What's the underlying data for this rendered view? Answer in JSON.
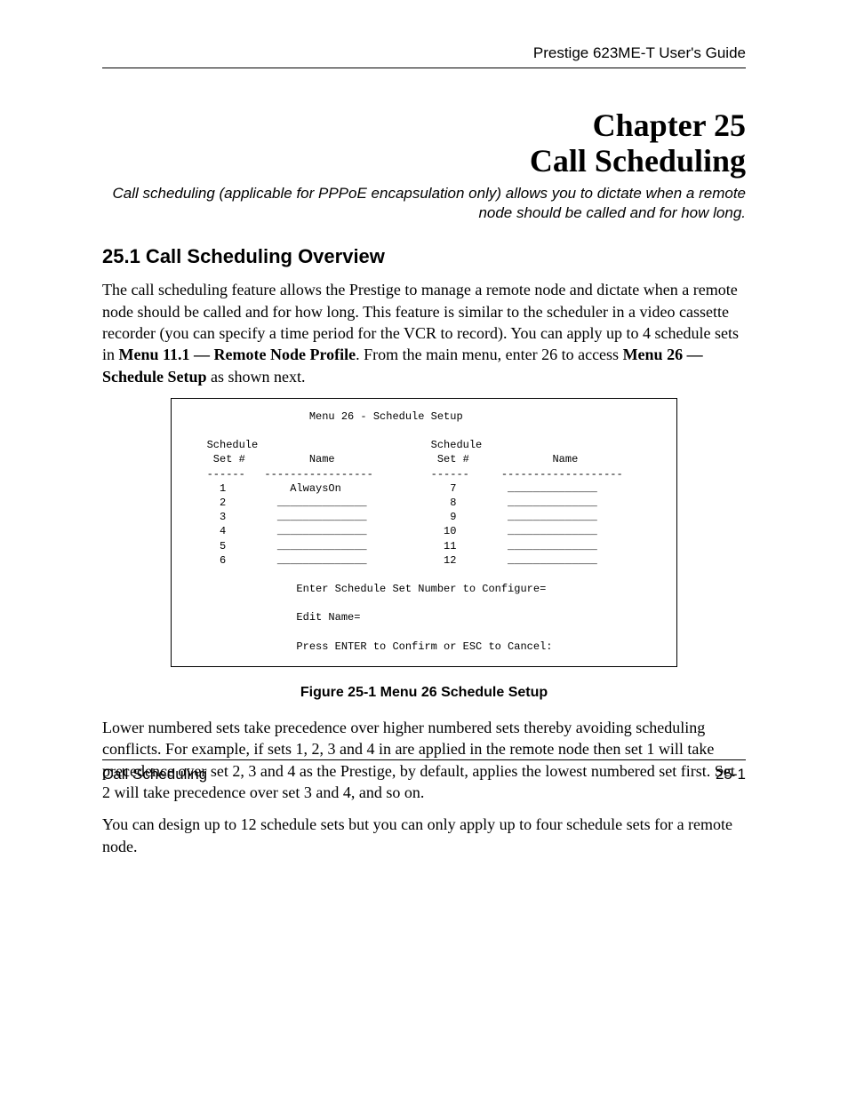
{
  "header": {
    "guide_title": "Prestige 623ME-T User's Guide"
  },
  "chapter": {
    "line1": "Chapter 25",
    "line2": "Call Scheduling"
  },
  "subtitle": "Call scheduling (applicable for  PPPoE encapsulation only) allows you to dictate when a remote node should be called and for how long.",
  "section_heading": "25.1  Call Scheduling Overview",
  "para1": {
    "t1": "The call scheduling feature allows the Prestige to manage a remote node and dictate when a remote node should be called and for how long. This feature is similar to the scheduler in a video cassette recorder (you can specify a time period for the VCR to record). You can apply up to 4 schedule sets in ",
    "b1": "Menu 11.1 — Remote Node Profile",
    "t2": ".  From the main menu, enter 26 to access ",
    "b2": "Menu 26 — Schedule Setup",
    "t3": " as shown next."
  },
  "terminal": {
    "title": "                   Menu 26 - Schedule Setup",
    "hdr1": "   Schedule                           Schedule",
    "hdr2": "    Set #          Name                Set #             Name",
    "sep": "   ------   -----------------         ------     -------------------",
    "row1": "     1          AlwaysOn                 7        ______________",
    "row2": "     2        ______________             8        ______________",
    "row3": "     3        ______________             9        ______________",
    "row4": "     4        ______________            10        ______________",
    "row5": "     5        ______________            11        ______________",
    "row6": "     6        ______________            12        ______________",
    "prompt1": "                 Enter Schedule Set Number to Configure=",
    "prompt2": "                 Edit Name=",
    "prompt3": "                 Press ENTER to Confirm or ESC to Cancel:"
  },
  "figure_caption": "Figure 25-1 Menu 26 Schedule Setup",
  "para2": "Lower numbered sets take precedence over higher numbered sets thereby avoiding scheduling conflicts. For example, if sets 1, 2, 3 and 4 in are applied in the remote node then set 1 will take precedence over set 2, 3 and 4 as the Prestige, by default, applies the lowest numbered set first.  Set 2 will take precedence over set 3 and 4, and so on.",
  "para3": "You can design up to 12 schedule sets but you can only apply up to four schedule sets for a remote node.",
  "footer": {
    "left": "Call Scheduling",
    "right": "25-1"
  }
}
